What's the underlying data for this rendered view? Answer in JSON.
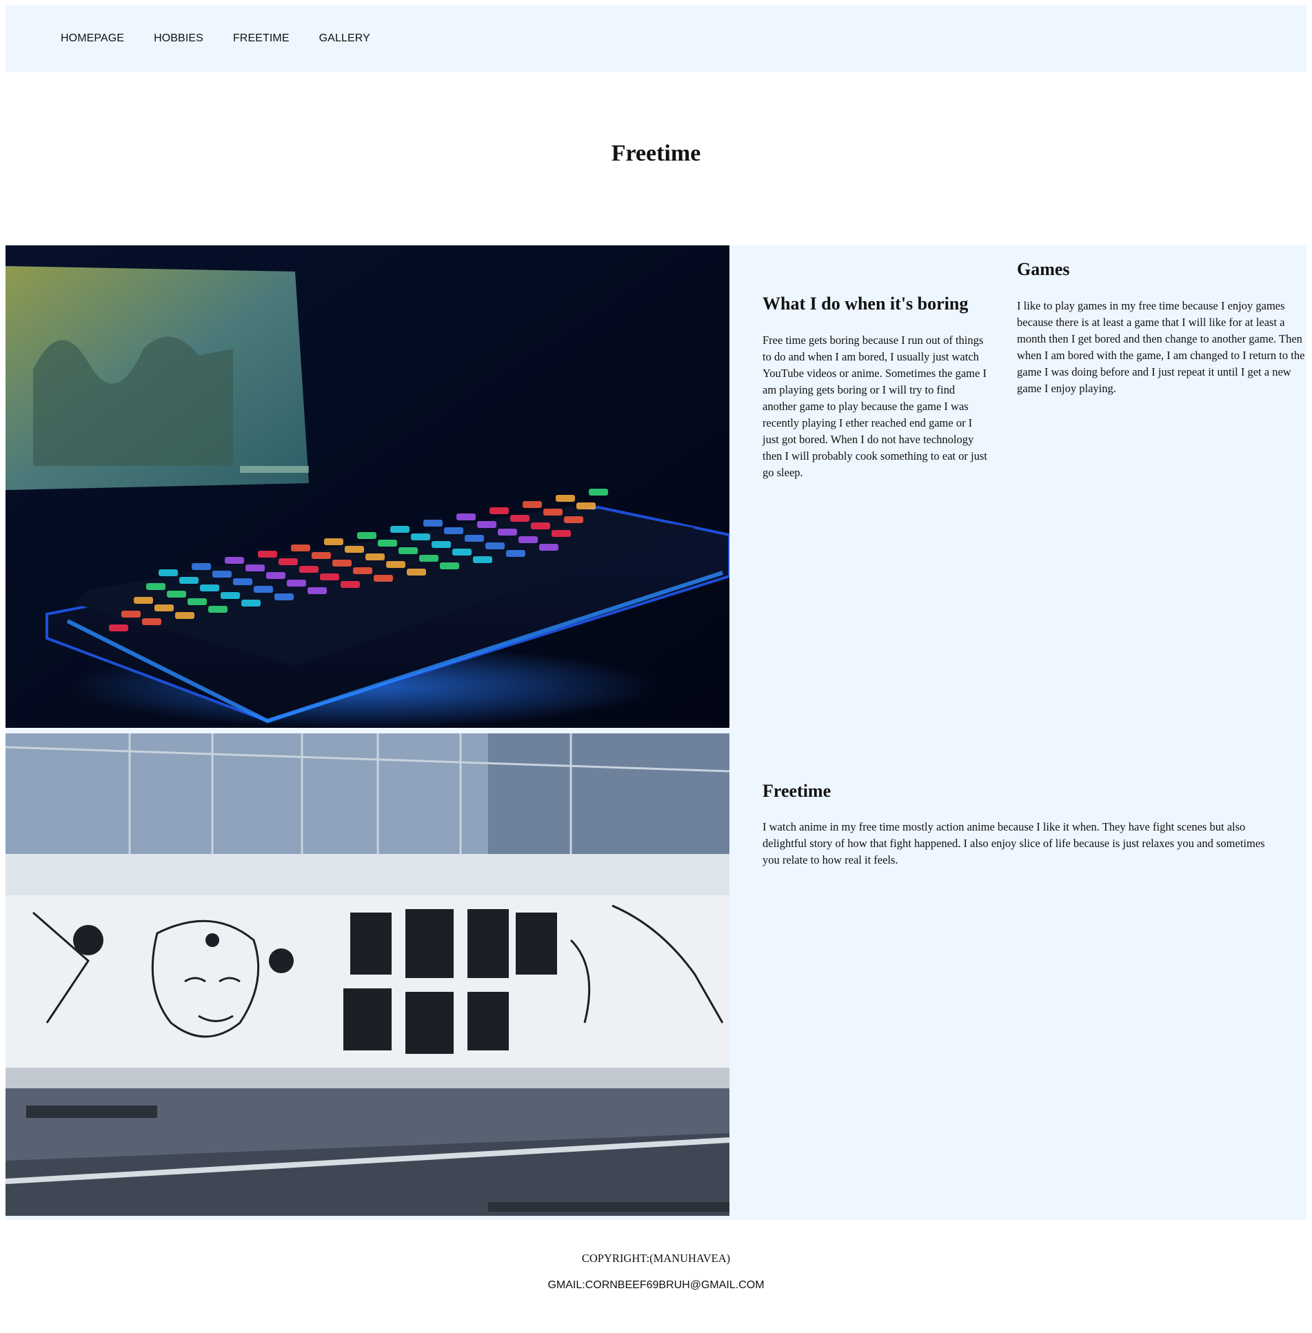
{
  "nav": {
    "items": [
      {
        "label": "HOMEPAGE"
      },
      {
        "label": "HOBBIES"
      },
      {
        "label": "FREETIME"
      },
      {
        "label": "GALLERY"
      }
    ]
  },
  "page": {
    "title": "Freetime"
  },
  "sections": {
    "boring": {
      "heading": "What I do when it's boring",
      "text": "Free time gets boring because I run out of things to do and when I am bored, I usually just watch YouTube videos or anime. Sometimes the game I am playing gets boring or I will try to find another game to play because the game I was recently playing I ether reached end game or I just got bored. When I do not have technology then I will probably cook something to eat or just go sleep."
    },
    "games": {
      "heading": "Games",
      "text": "I like to play games in my free time because I enjoy games because there is at least a game that I will like for at least a month then I get bored and then change to another game. Then when I am bored with the game, I am changed to I return to the game I was doing before and I just repeat it until I get a new game I enjoy playing."
    },
    "freetime": {
      "heading": "Freetime",
      "text": "I watch anime in my free time mostly action anime because I like it when. They have fight scenes but also delightful story of how that fight happened. I also enjoy slice of life because is just relaxes you and sometimes you relate to how real it feels."
    }
  },
  "images": {
    "photo1": {
      "icon": "gaming-keyboard-photo"
    },
    "photo2": {
      "icon": "anime-mural-photo"
    }
  },
  "footer": {
    "copyright": "COPYRIGHT:(MANUHAVEA)",
    "email": "GMAIL:CORNBEEF69BRUH@GMAIL.COM"
  },
  "colors": {
    "nav_background": "#eef6ff",
    "section_background": "#eef6ff",
    "text": "#111111"
  }
}
